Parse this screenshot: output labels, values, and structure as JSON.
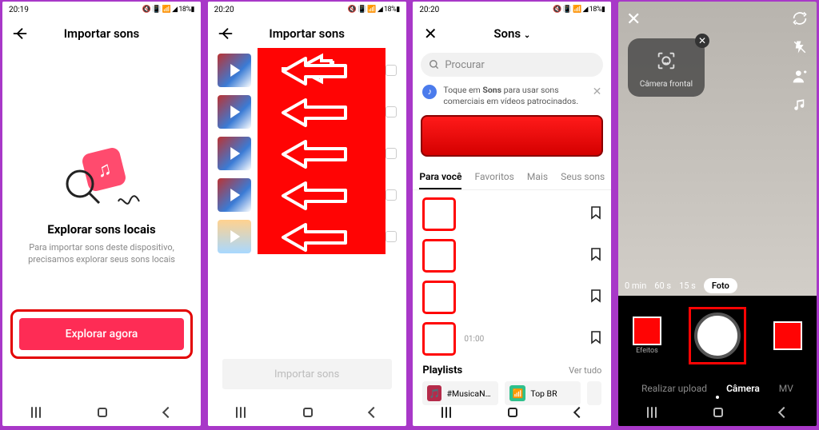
{
  "status_bar": {
    "time_a": "20:19",
    "time_b": "20:20",
    "right": "📶 📶 📳 🔇 ⏰ 18% 🔋",
    "right_icons": "▶ ▶ ▣ 💬"
  },
  "screen1": {
    "title": "Importar sons",
    "heading": "Explorar sons locais",
    "subtext": "Para importar sons deste dispositivo, precisamos explorar seus sons locais",
    "button": "Explorar agora"
  },
  "screen2": {
    "title": "Importar sons",
    "import_btn": "Importar sons",
    "item_count": 5
  },
  "screen3": {
    "title": "Sons",
    "search_placeholder": "Procurar",
    "tip_prefix": "Toque em ",
    "tip_bold": "Sons",
    "tip_suffix": " para usar sons comerciais em vídeos patrocinados.",
    "tabs": [
      "Para você",
      "Favoritos",
      "Mais",
      "Seus sons"
    ],
    "active_tab": 0,
    "track_time": "01:00",
    "playlists_label": "Playlists",
    "see_all": "Ver tudo",
    "playlists": [
      {
        "name": "#MusicaNova",
        "icon": "🎵",
        "bg": "#b52b4a"
      },
      {
        "name": "Top BR",
        "icon": "📶",
        "bg": "#2fc18c"
      }
    ]
  },
  "screen4": {
    "tooltip": "Câmera frontal",
    "durations": [
      "0 min",
      "60 s",
      "15 s",
      "Foto"
    ],
    "active_duration": 3,
    "left_mode": "Efeitos",
    "modes": [
      "Realizar upload",
      "Câmera",
      "MV"
    ],
    "active_mode": 1
  }
}
